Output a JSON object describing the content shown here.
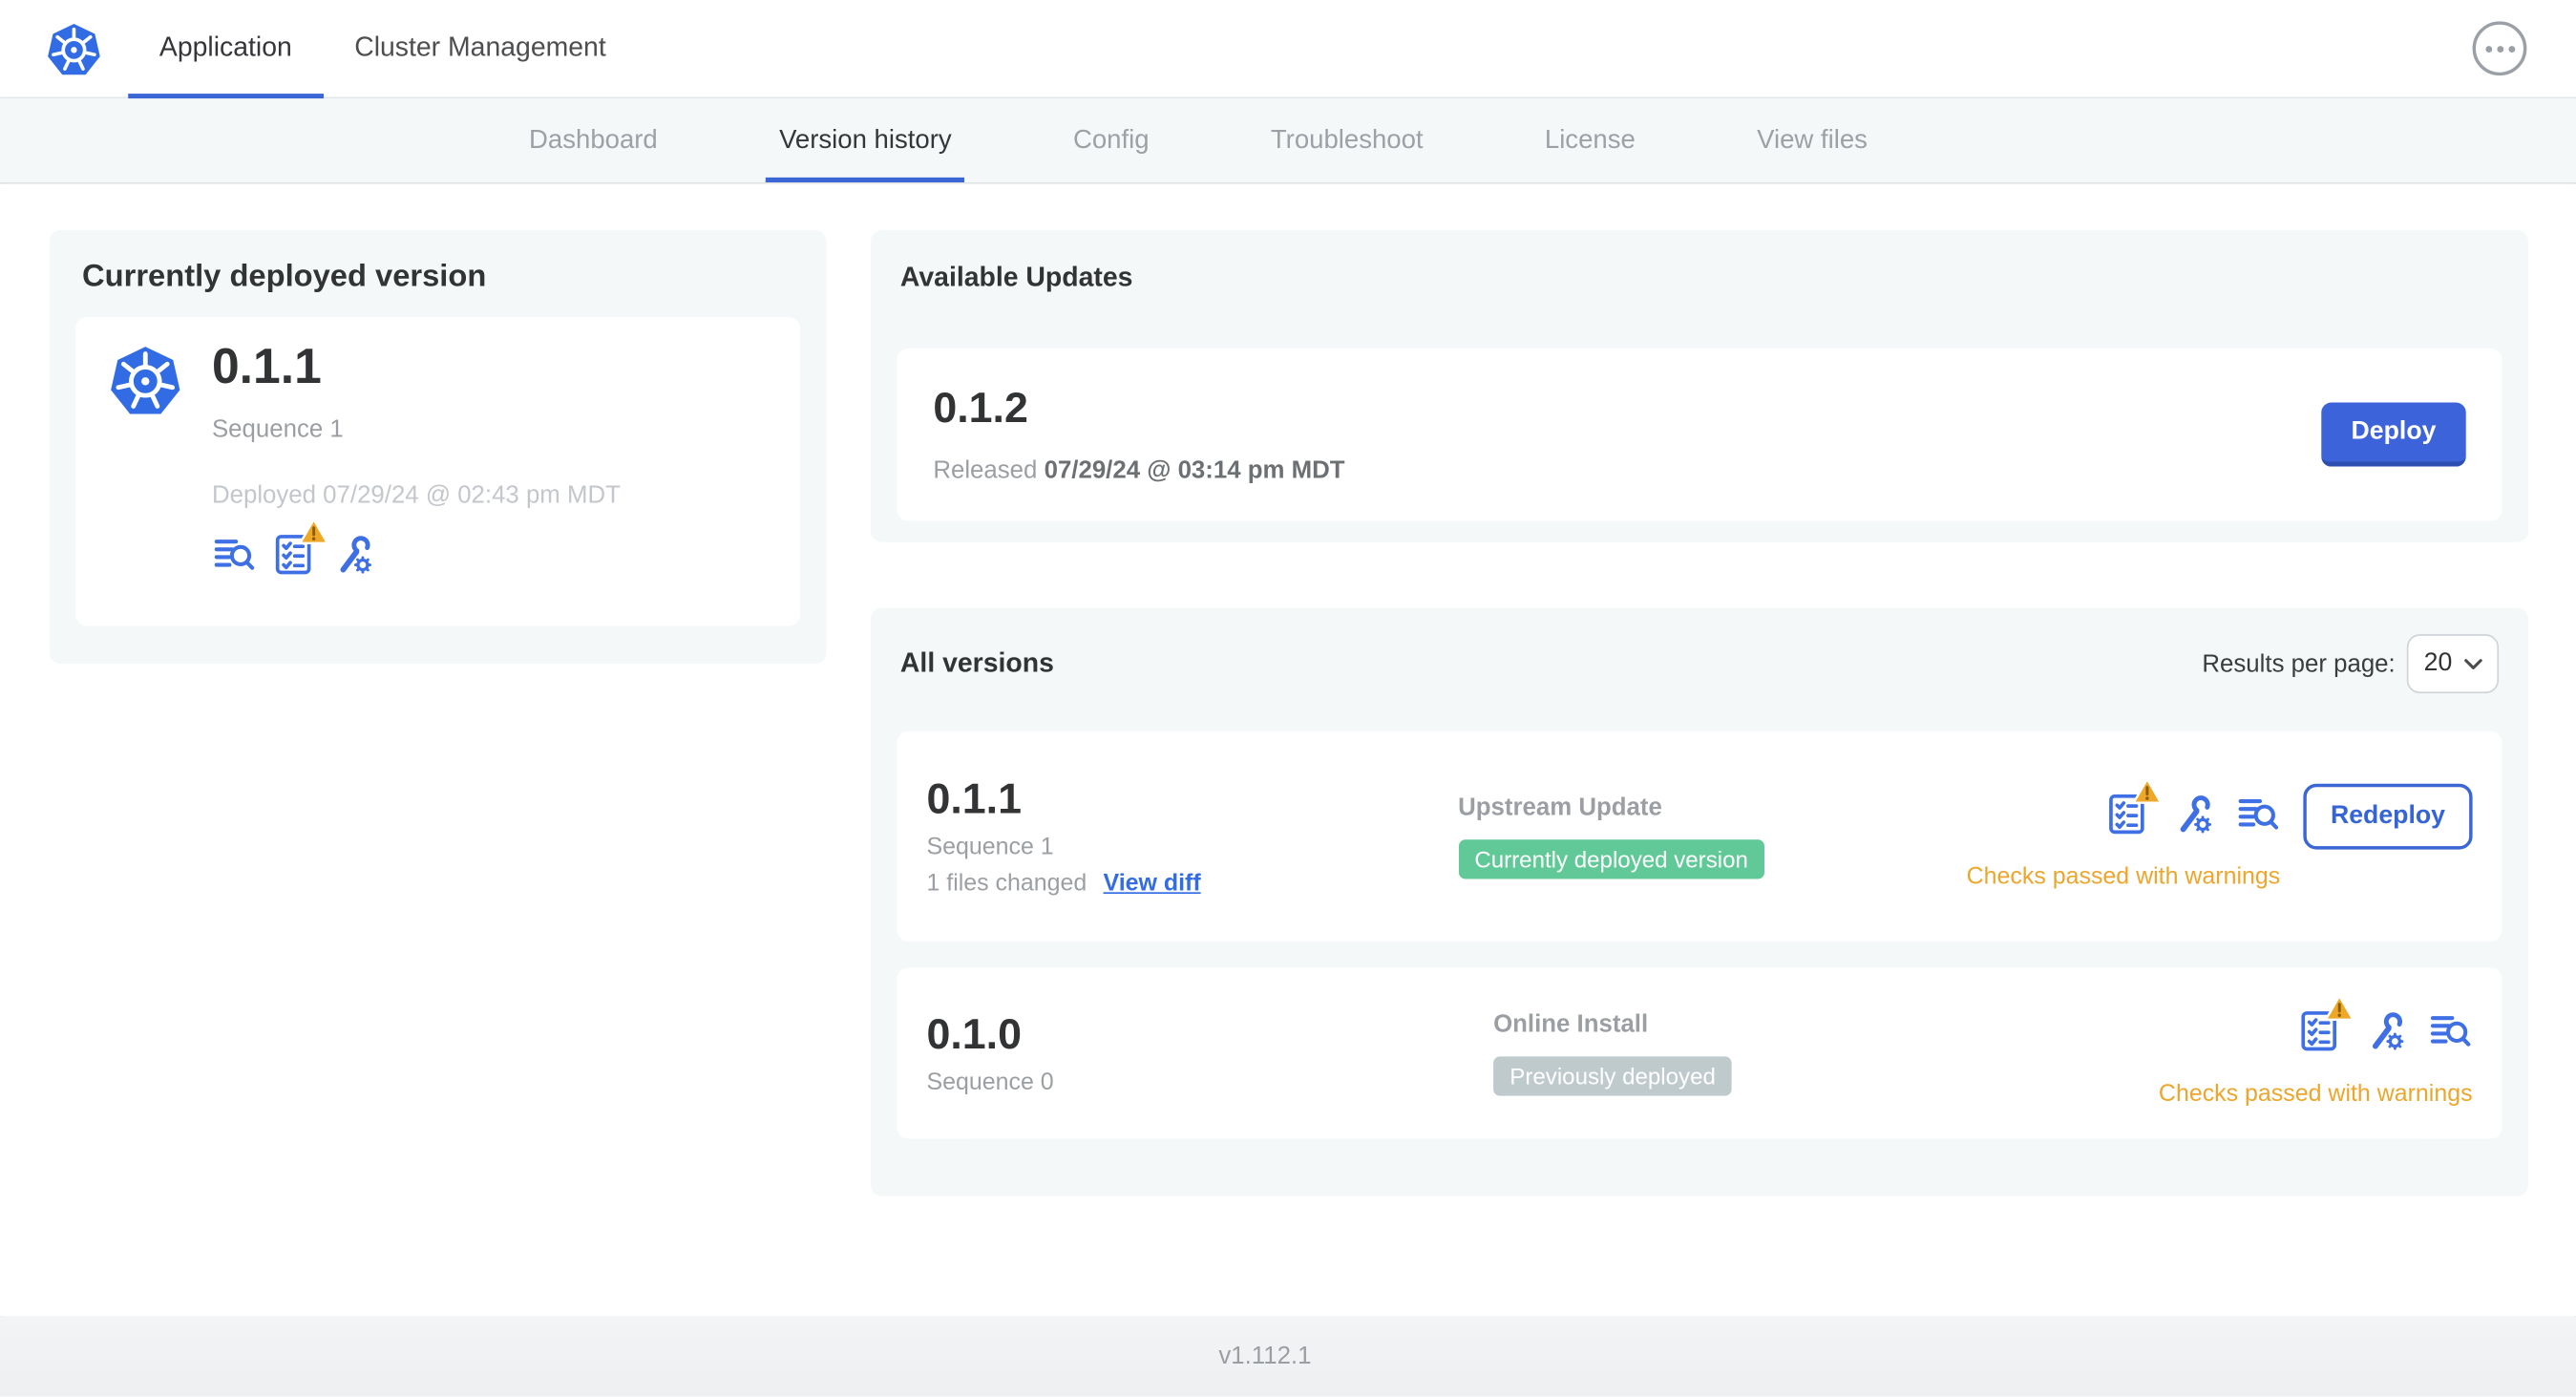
{
  "header": {
    "app_tabs": [
      {
        "label": "Application",
        "active": true
      },
      {
        "label": "Cluster Management",
        "active": false
      }
    ],
    "more_menu_icon": "ellipsis-in-circle"
  },
  "nav": {
    "tabs": [
      {
        "label": "Dashboard",
        "active": false
      },
      {
        "label": "Version history",
        "active": true
      },
      {
        "label": "Config",
        "active": false
      },
      {
        "label": "Troubleshoot",
        "active": false
      },
      {
        "label": "License",
        "active": false
      },
      {
        "label": "View files",
        "active": false
      }
    ]
  },
  "currently_deployed": {
    "title": "Currently deployed version",
    "version": "0.1.1",
    "sequence": "Sequence 1",
    "deployed_at": "Deployed 07/29/24 @ 02:43 pm MDT",
    "icons": [
      "view-logs-icon",
      "preflight-checks-warning-icon",
      "config-wrench-icon"
    ]
  },
  "available_updates": {
    "title": "Available Updates",
    "version": "0.1.2",
    "released_label": "Released",
    "released_at": "07/29/24 @ 03:14 pm MDT",
    "deploy_label": "Deploy"
  },
  "all_versions": {
    "title": "All versions",
    "results_per_page_label": "Results per page:",
    "results_per_page_value": "20",
    "rows": [
      {
        "version": "0.1.1",
        "sequence": "Sequence 1",
        "files_changed": "1 files changed",
        "diff_link": "View diff",
        "source": "Upstream Update",
        "badge": "Currently deployed version",
        "badge_type": "green",
        "status": "Checks passed with warnings",
        "action_label": "Redeploy",
        "icons": [
          "preflight-checks-warning-icon",
          "config-wrench-icon",
          "view-logs-icon"
        ]
      },
      {
        "version": "0.1.0",
        "sequence": "Sequence 0",
        "source": "Online Install",
        "badge": "Previously deployed",
        "badge_type": "gray",
        "status": "Checks passed with warnings",
        "icons": [
          "preflight-checks-warning-icon",
          "config-wrench-icon",
          "view-logs-icon"
        ]
      }
    ]
  },
  "footer": {
    "version": "v1.112.1"
  },
  "colors": {
    "accent_blue": "#3b66d6",
    "kubernetes_blue": "#326ce5",
    "deploy_button": "#3c63d9",
    "link_blue": "#326de6",
    "badge_green": "#61c997",
    "badge_gray": "#bfcacd",
    "warning_amber": "#eda62b",
    "card_gray": "#f5f8f9",
    "text_dark": "#323335",
    "text_gray": "#9b9fa3"
  }
}
